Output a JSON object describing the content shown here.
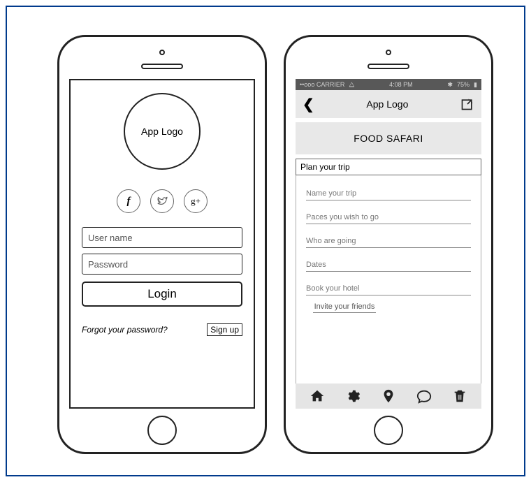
{
  "left": {
    "logo_label": "App Logo",
    "social": {
      "facebook": "f",
      "twitter": "t",
      "google": "g+"
    },
    "username_placeholder": "User name",
    "password_placeholder": "Password",
    "login_label": "Login",
    "forgot_label": "Forgot your password?",
    "signup_label": "Sign up"
  },
  "right": {
    "status": {
      "carrier": "••ooo  CARRIER",
      "wifi": "⧋",
      "time": "4:08 PM",
      "bt": "✱",
      "battery": "75%",
      "batt_icon": "▮"
    },
    "nav": {
      "back": "❮",
      "title": "App Logo"
    },
    "banner": "FOOD SAFARI",
    "section": "Plan your trip",
    "fields": {
      "name": "Name your trip",
      "places": "Paces you wish to go",
      "who": "Who are going",
      "dates": "Dates",
      "hotel": "Book your hotel"
    },
    "invite": "Invite your friends"
  }
}
